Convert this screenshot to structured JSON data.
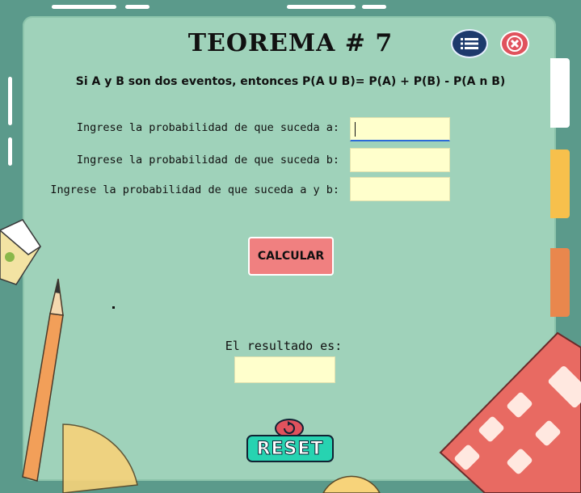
{
  "header": {
    "title": "TEOREMA # 7",
    "formula": "Si A y B son dos eventos, entonces P(A U B)= P(A) + P(B) - P(A n B)"
  },
  "form": {
    "fields": [
      {
        "label": "Ingrese la probabilidad de que suceda a:",
        "value": ""
      },
      {
        "label": "Ingrese la probabilidad de que suceda b:",
        "value": ""
      },
      {
        "label": "Ingrese la probabilidad de que suceda a y b:",
        "value": ""
      }
    ],
    "calculate_label": "CALCULAR"
  },
  "result": {
    "label": "El resultado es:",
    "value": ""
  },
  "reset_label": "RESET",
  "icons": {
    "menu": "list-icon",
    "close": "close-icon",
    "reset": "refresh-icon"
  },
  "colors": {
    "board": "#9fd2ba",
    "input_bg": "#ffffcc",
    "calculate_bg": "#f08080",
    "reset_bg": "#27d3b1",
    "menu_bg": "#1d3a6c",
    "close_bg": "#e0525d"
  }
}
